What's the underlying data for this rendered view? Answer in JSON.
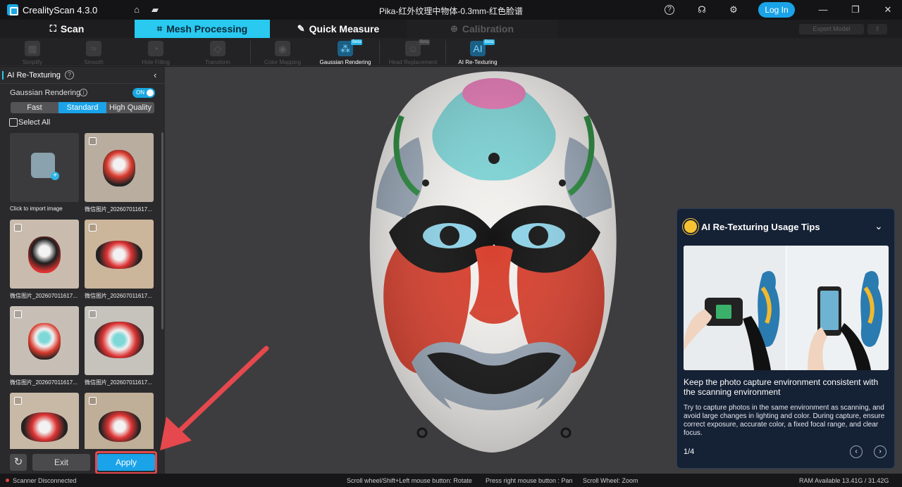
{
  "app": {
    "title": "CrealityScan 4.3.0",
    "document_title": "Pika-红外纹理中物体-0.3mm-红色脸谱",
    "login_label": "Log In"
  },
  "titlebar_icons": [
    "home-icon",
    "folder-icon",
    "help-circle-icon",
    "headset-icon",
    "gear-icon"
  ],
  "tabs": [
    {
      "label": "Scan",
      "icon": "scan-icon"
    },
    {
      "label": "Mesh Processing",
      "icon": "crop-icon"
    },
    {
      "label": "Quick Measure",
      "icon": "ruler-icon"
    },
    {
      "label": "Calibration",
      "icon": "target-icon"
    }
  ],
  "header_actions": {
    "export_label": "Export Model"
  },
  "tools": [
    {
      "label": "Simplify",
      "state": "disabled"
    },
    {
      "label": "Smooth",
      "state": "disabled"
    },
    {
      "label": "Hole Filling",
      "state": "disabled"
    },
    {
      "label": "Transform",
      "state": "disabled"
    },
    {
      "label": "Color Mapping",
      "state": "disabled"
    },
    {
      "label": "Gaussian Rendering",
      "state": "enabled",
      "beta": "Beta"
    },
    {
      "label": "Head Replacement",
      "state": "disabled",
      "beta": "Beta"
    },
    {
      "label": "AI Re-Texturing",
      "state": "enabled",
      "beta": "Beta"
    }
  ],
  "panel": {
    "title": "AI Re-Texturing",
    "gaussian_label": "Gaussian Rendering",
    "toggle_text": "ON",
    "quality_options": [
      "Fast",
      "Standard",
      "High Quality"
    ],
    "quality_selected": "Standard",
    "select_all": "Select All",
    "import_caption": "Click to import image",
    "images": [
      "微信图片_2026070116170",
      "微信图片_2026070116170",
      "微信图片_2026070116170",
      "微信图片_2026070116170",
      "微信图片_2026070116170",
      "微信图片_2026070116170",
      "微信图片_2026070116170"
    ],
    "image_caption_display": "微信图片_202607011617...",
    "exit_label": "Exit",
    "apply_label": "Apply"
  },
  "tips": {
    "title": "AI Re-Texturing Usage Tips",
    "heading": "Keep the photo capture environment consistent with the scanning environment",
    "body": "Try to capture photos in the same environment as scanning, and avoid large changes in lighting and color. During capture, ensure correct exposure, accurate color, a fixed focal range, and clear focus.",
    "page": "1/4"
  },
  "status": {
    "scanner": "Scanner Disconnected",
    "hint_rotate": "Scroll wheel/Shift+Left mouse button: Rotate",
    "hint_pan": "Press right mouse button : Pan",
    "hint_zoom": "Scroll Wheel: Zoom",
    "ram": "RAM Available 13.41G / 31.42G"
  },
  "colors": {
    "accent": "#1aa3e8",
    "active_tab": "#29c9f0",
    "highlight": "#e5484d"
  }
}
